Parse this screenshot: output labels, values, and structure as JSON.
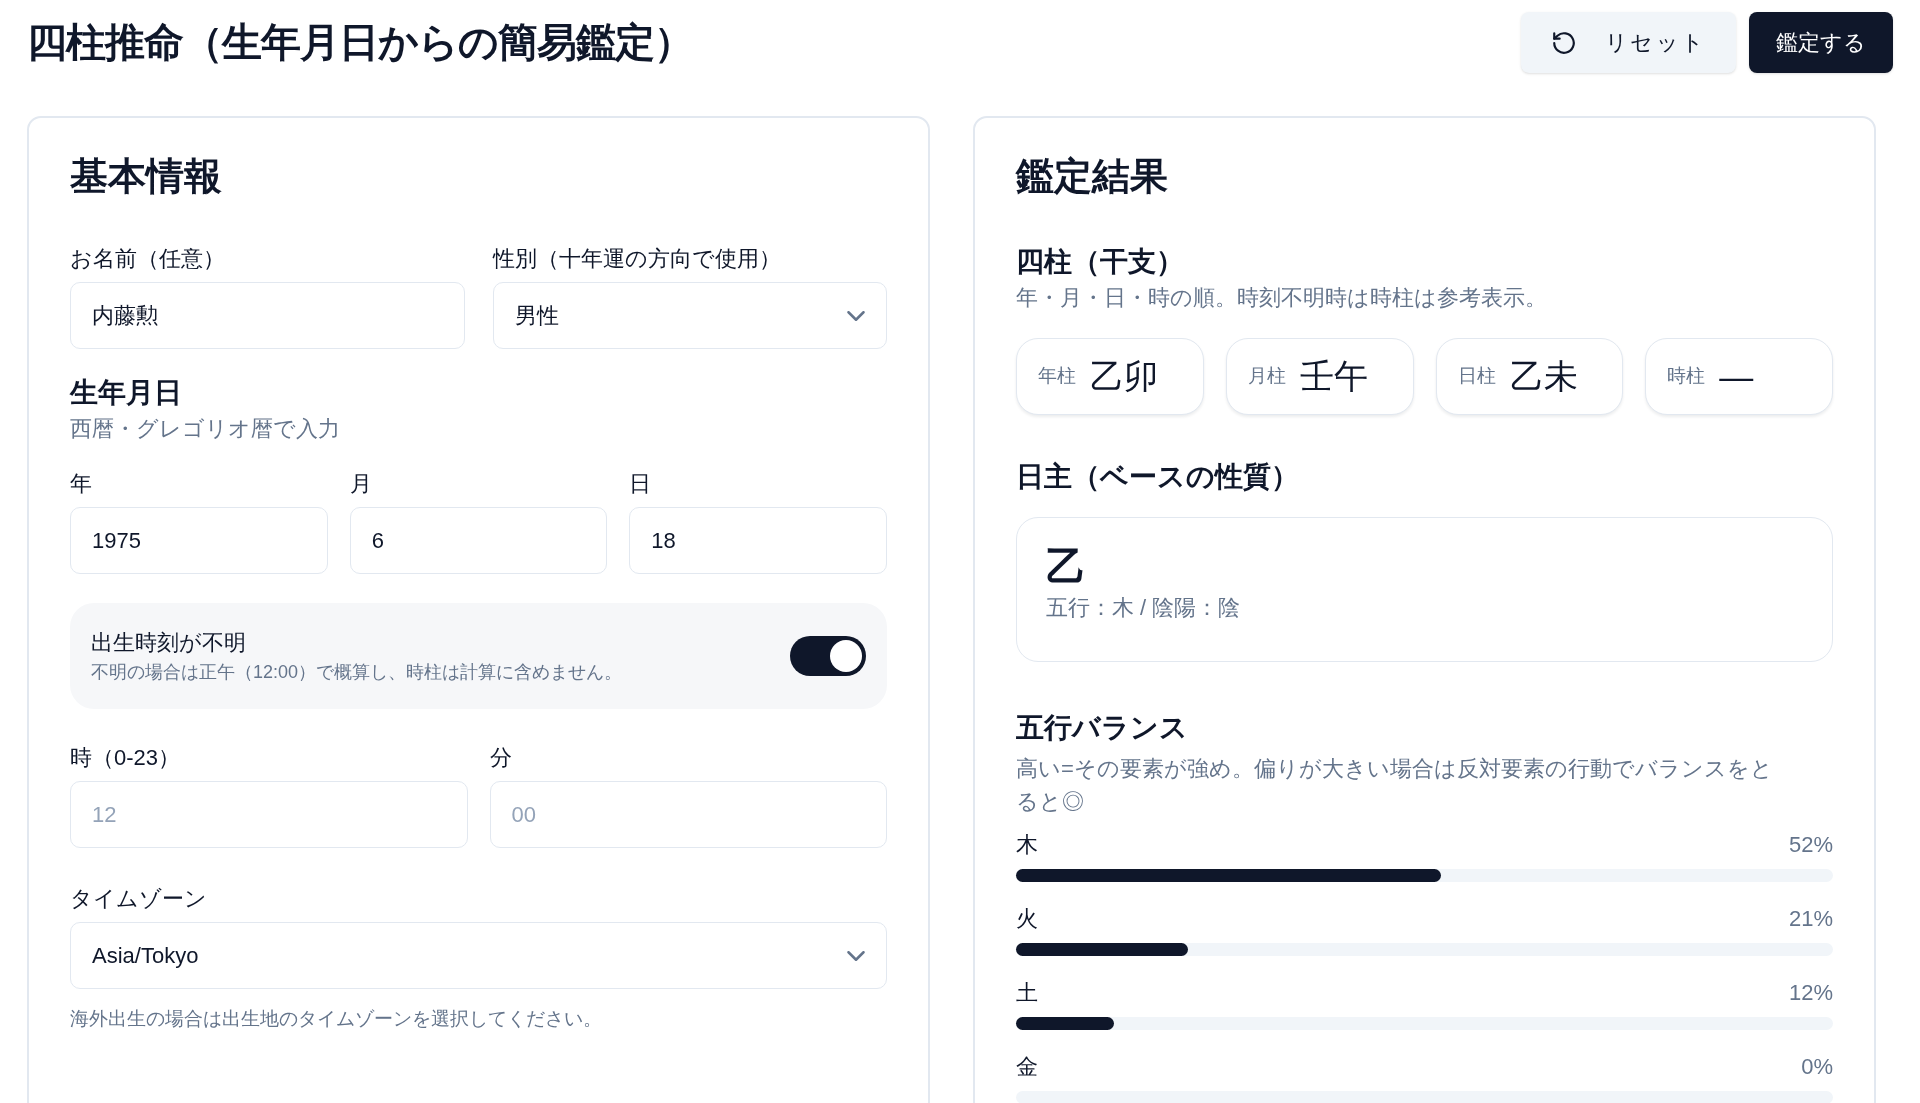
{
  "title": "四柱推命（生年月日からの簡易鑑定）",
  "actions": [
    {
      "kind": "secondary",
      "label": "リセット"
    },
    {
      "kind": "primary",
      "label": "鑑定する"
    }
  ],
  "basic_info": {
    "heading": "基本情報",
    "name_field": {
      "label": "お名前（任意）",
      "value": "内藤勲"
    },
    "gender_select": {
      "label": "性別（十年運の方向で使用）",
      "value": "男性"
    },
    "birth_date": {
      "heading": "生年月日",
      "note": "西暦・グレゴリオ暦で入力",
      "fields": [
        {
          "label": "年",
          "value": "1975"
        },
        {
          "label": "月",
          "value": "6"
        },
        {
          "label": "日",
          "value": "18"
        }
      ]
    },
    "unknown_time": {
      "label": "出生時刻が不明",
      "note": "不明の場合は正午（12:00）で概算し、時柱は計算に含めません。",
      "on": true
    },
    "time_fields": [
      {
        "label": "時（0-23）",
        "value": "12",
        "disabled": true
      },
      {
        "label": "分",
        "value": "00",
        "disabled": true
      }
    ],
    "timezone_select": {
      "label": "タイムゾーン",
      "value": "Asia/Tokyo",
      "hint": "海外出生の場合は出生地のタイムゾーンを選択してください。"
    }
  },
  "result": {
    "heading": "鑑定結果",
    "pillars": {
      "heading": "四柱（干支）",
      "note": "年・月・日・時の順。時刻不明時は時柱は参考表示。",
      "items": [
        {
          "label": "年柱",
          "value": "乙卯"
        },
        {
          "label": "月柱",
          "value": "壬午"
        },
        {
          "label": "日柱",
          "value": "乙未"
        },
        {
          "label": "時柱",
          "value": "—"
        }
      ]
    },
    "day_master": {
      "heading": "日主（ベースの性質）",
      "stem": "乙",
      "detail": "五行：木 / 陰陽：陰"
    },
    "balance": {
      "heading": "五行バランス",
      "note": "高い=その要素が強め。偏りが大きい場合は反対要素の行動でバランスをとると◎",
      "items": [
        {
          "label": "木",
          "reading": "52%",
          "level": 0.52
        },
        {
          "label": "火",
          "reading": "21%",
          "level": 0.21
        },
        {
          "label": "土",
          "reading": "12%",
          "level": 0.12
        },
        {
          "label": "金",
          "reading": "0%",
          "level": 0
        }
      ]
    }
  }
}
